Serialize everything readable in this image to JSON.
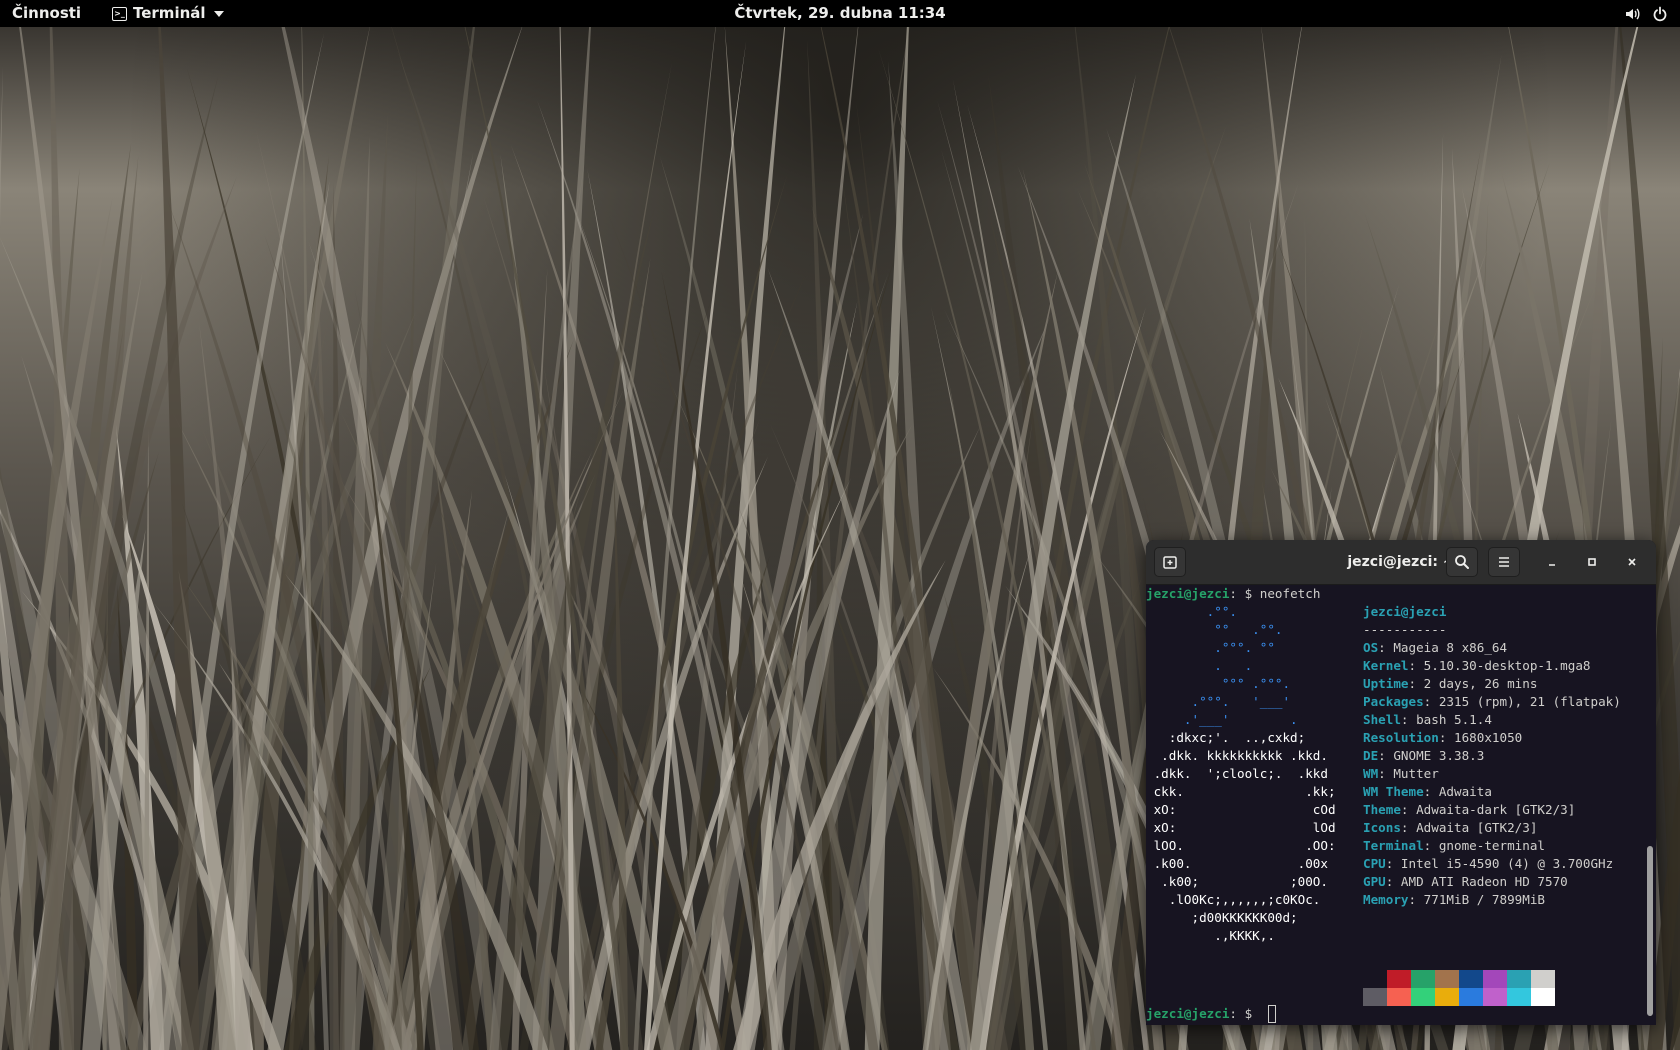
{
  "topbar": {
    "activities": "Činnosti",
    "app_name": "Terminál",
    "clock": "Čtvrtek, 29. dubna 11:34",
    "icons": [
      "volume-icon",
      "power-icon"
    ]
  },
  "terminal": {
    "title": "jezci@jezci: ~",
    "prompt_user": "jezci@jezci",
    "prompt_suffix": ": $",
    "command": " neofetch",
    "ascii_art": [
      "        .°°.",
      "         °°   .°°.",
      "         .°°°. °°",
      "         .   .",
      "          °°° .°°°.",
      "      .°°°.   '___'",
      "     .'___'        .",
      "   :dkxc;'.  ..,cxkd;",
      "  .dkk. kkkkkkkkkk .kkd.",
      " .dkk.  ';cloolc;.  .kkd",
      " ckk.                .kk;",
      " xO:                  cOd",
      " xO:                  lOd",
      " lOO.                .OO:",
      " .k00.              .00x",
      "  .k00;            ;00O.",
      "   .lO0Kc;,,,,,,;c0KOc.",
      "      ;d00KKKKKK00d;",
      "         .,KKKK,."
    ],
    "user_host": "jezci@jezci",
    "separator": "-----------",
    "info": [
      {
        "key": "OS",
        "value": "Mageia 8 x86_64"
      },
      {
        "key": "Kernel",
        "value": "5.10.30-desktop-1.mga8"
      },
      {
        "key": "Uptime",
        "value": "2 days, 26 mins"
      },
      {
        "key": "Packages",
        "value": "2315 (rpm), 21 (flatpak)"
      },
      {
        "key": "Shell",
        "value": "bash 5.1.4"
      },
      {
        "key": "Resolution",
        "value": "1680x1050"
      },
      {
        "key": "DE",
        "value": "GNOME 3.38.3"
      },
      {
        "key": "WM",
        "value": "Mutter"
      },
      {
        "key": "WM Theme",
        "value": "Adwaita"
      },
      {
        "key": "Theme",
        "value": "Adwaita-dark [GTK2/3]"
      },
      {
        "key": "Icons",
        "value": "Adwaita [GTK2/3]"
      },
      {
        "key": "Terminal",
        "value": "gnome-terminal"
      },
      {
        "key": "CPU",
        "value": "Intel i5-4590 (4) @ 3.700GHz"
      },
      {
        "key": "GPU",
        "value": "AMD ATI Radeon HD 7570"
      },
      {
        "key": "Memory",
        "value": "771MiB / 7899MiB"
      }
    ],
    "palette_dark": [
      "#171421",
      "#c01c28",
      "#26a269",
      "#a2734c",
      "#12488b",
      "#a347ba",
      "#2aa1b3",
      "#d0cfcc"
    ],
    "palette_bright": [
      "#5e5c64",
      "#f66151",
      "#33d17a",
      "#e9ad0c",
      "#2a7bde",
      "#c061cb",
      "#33c7de",
      "#ffffff"
    ]
  }
}
